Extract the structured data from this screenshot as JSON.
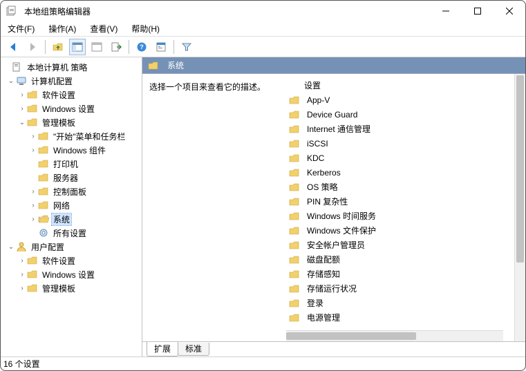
{
  "window": {
    "title": "本地组策略编辑器"
  },
  "menu": {
    "file": "文件(F)",
    "action": "操作(A)",
    "view": "查看(V)",
    "help": "帮助(H)"
  },
  "tree": {
    "root": "本地计算机 策略",
    "computer_config": "计算机配置",
    "software_settings": "软件设置",
    "windows_settings": "Windows 设置",
    "admin_templates": "管理模板",
    "start_taskbar": "\"开始\"菜单和任务栏",
    "windows_components": "Windows 组件",
    "printers": "打印机",
    "server": "服务器",
    "control_panel": "控制面板",
    "network": "网络",
    "system": "系统",
    "all_settings": "所有设置",
    "user_config": "用户配置",
    "user_software": "软件设置",
    "user_windows": "Windows 设置",
    "user_admin": "管理模板"
  },
  "content": {
    "header": "系统",
    "desc_prompt": "选择一个项目来查看它的描述。",
    "cols": {
      "settings": "设置"
    },
    "items": [
      "App-V",
      "Device Guard",
      "Internet 通信管理",
      "iSCSI",
      "KDC",
      "Kerberos",
      "OS 策略",
      "PIN 复杂性",
      "Windows 时间服务",
      "Windows 文件保护",
      "安全帐户管理员",
      "磁盘配额",
      "存储感知",
      "存储运行状况",
      "登录",
      "电源管理"
    ]
  },
  "tabs": {
    "extended": "扩展",
    "standard": "标准"
  },
  "status": "16 个设置"
}
